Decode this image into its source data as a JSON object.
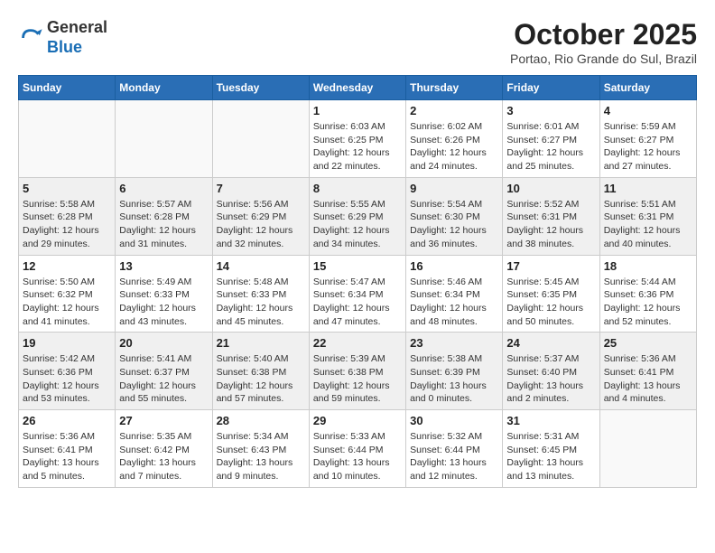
{
  "header": {
    "logo_line1": "General",
    "logo_line2": "Blue",
    "month_title": "October 2025",
    "location": "Portao, Rio Grande do Sul, Brazil"
  },
  "days_of_week": [
    "Sunday",
    "Monday",
    "Tuesday",
    "Wednesday",
    "Thursday",
    "Friday",
    "Saturday"
  ],
  "weeks": [
    {
      "shaded": false,
      "days": [
        {
          "num": "",
          "info": ""
        },
        {
          "num": "",
          "info": ""
        },
        {
          "num": "",
          "info": ""
        },
        {
          "num": "1",
          "info": "Sunrise: 6:03 AM\nSunset: 6:25 PM\nDaylight: 12 hours\nand 22 minutes."
        },
        {
          "num": "2",
          "info": "Sunrise: 6:02 AM\nSunset: 6:26 PM\nDaylight: 12 hours\nand 24 minutes."
        },
        {
          "num": "3",
          "info": "Sunrise: 6:01 AM\nSunset: 6:27 PM\nDaylight: 12 hours\nand 25 minutes."
        },
        {
          "num": "4",
          "info": "Sunrise: 5:59 AM\nSunset: 6:27 PM\nDaylight: 12 hours\nand 27 minutes."
        }
      ]
    },
    {
      "shaded": true,
      "days": [
        {
          "num": "5",
          "info": "Sunrise: 5:58 AM\nSunset: 6:28 PM\nDaylight: 12 hours\nand 29 minutes."
        },
        {
          "num": "6",
          "info": "Sunrise: 5:57 AM\nSunset: 6:28 PM\nDaylight: 12 hours\nand 31 minutes."
        },
        {
          "num": "7",
          "info": "Sunrise: 5:56 AM\nSunset: 6:29 PM\nDaylight: 12 hours\nand 32 minutes."
        },
        {
          "num": "8",
          "info": "Sunrise: 5:55 AM\nSunset: 6:29 PM\nDaylight: 12 hours\nand 34 minutes."
        },
        {
          "num": "9",
          "info": "Sunrise: 5:54 AM\nSunset: 6:30 PM\nDaylight: 12 hours\nand 36 minutes."
        },
        {
          "num": "10",
          "info": "Sunrise: 5:52 AM\nSunset: 6:31 PM\nDaylight: 12 hours\nand 38 minutes."
        },
        {
          "num": "11",
          "info": "Sunrise: 5:51 AM\nSunset: 6:31 PM\nDaylight: 12 hours\nand 40 minutes."
        }
      ]
    },
    {
      "shaded": false,
      "days": [
        {
          "num": "12",
          "info": "Sunrise: 5:50 AM\nSunset: 6:32 PM\nDaylight: 12 hours\nand 41 minutes."
        },
        {
          "num": "13",
          "info": "Sunrise: 5:49 AM\nSunset: 6:33 PM\nDaylight: 12 hours\nand 43 minutes."
        },
        {
          "num": "14",
          "info": "Sunrise: 5:48 AM\nSunset: 6:33 PM\nDaylight: 12 hours\nand 45 minutes."
        },
        {
          "num": "15",
          "info": "Sunrise: 5:47 AM\nSunset: 6:34 PM\nDaylight: 12 hours\nand 47 minutes."
        },
        {
          "num": "16",
          "info": "Sunrise: 5:46 AM\nSunset: 6:34 PM\nDaylight: 12 hours\nand 48 minutes."
        },
        {
          "num": "17",
          "info": "Sunrise: 5:45 AM\nSunset: 6:35 PM\nDaylight: 12 hours\nand 50 minutes."
        },
        {
          "num": "18",
          "info": "Sunrise: 5:44 AM\nSunset: 6:36 PM\nDaylight: 12 hours\nand 52 minutes."
        }
      ]
    },
    {
      "shaded": true,
      "days": [
        {
          "num": "19",
          "info": "Sunrise: 5:42 AM\nSunset: 6:36 PM\nDaylight: 12 hours\nand 53 minutes."
        },
        {
          "num": "20",
          "info": "Sunrise: 5:41 AM\nSunset: 6:37 PM\nDaylight: 12 hours\nand 55 minutes."
        },
        {
          "num": "21",
          "info": "Sunrise: 5:40 AM\nSunset: 6:38 PM\nDaylight: 12 hours\nand 57 minutes."
        },
        {
          "num": "22",
          "info": "Sunrise: 5:39 AM\nSunset: 6:38 PM\nDaylight: 12 hours\nand 59 minutes."
        },
        {
          "num": "23",
          "info": "Sunrise: 5:38 AM\nSunset: 6:39 PM\nDaylight: 13 hours\nand 0 minutes."
        },
        {
          "num": "24",
          "info": "Sunrise: 5:37 AM\nSunset: 6:40 PM\nDaylight: 13 hours\nand 2 minutes."
        },
        {
          "num": "25",
          "info": "Sunrise: 5:36 AM\nSunset: 6:41 PM\nDaylight: 13 hours\nand 4 minutes."
        }
      ]
    },
    {
      "shaded": false,
      "days": [
        {
          "num": "26",
          "info": "Sunrise: 5:36 AM\nSunset: 6:41 PM\nDaylight: 13 hours\nand 5 minutes."
        },
        {
          "num": "27",
          "info": "Sunrise: 5:35 AM\nSunset: 6:42 PM\nDaylight: 13 hours\nand 7 minutes."
        },
        {
          "num": "28",
          "info": "Sunrise: 5:34 AM\nSunset: 6:43 PM\nDaylight: 13 hours\nand 9 minutes."
        },
        {
          "num": "29",
          "info": "Sunrise: 5:33 AM\nSunset: 6:44 PM\nDaylight: 13 hours\nand 10 minutes."
        },
        {
          "num": "30",
          "info": "Sunrise: 5:32 AM\nSunset: 6:44 PM\nDaylight: 13 hours\nand 12 minutes."
        },
        {
          "num": "31",
          "info": "Sunrise: 5:31 AM\nSunset: 6:45 PM\nDaylight: 13 hours\nand 13 minutes."
        },
        {
          "num": "",
          "info": ""
        }
      ]
    }
  ]
}
